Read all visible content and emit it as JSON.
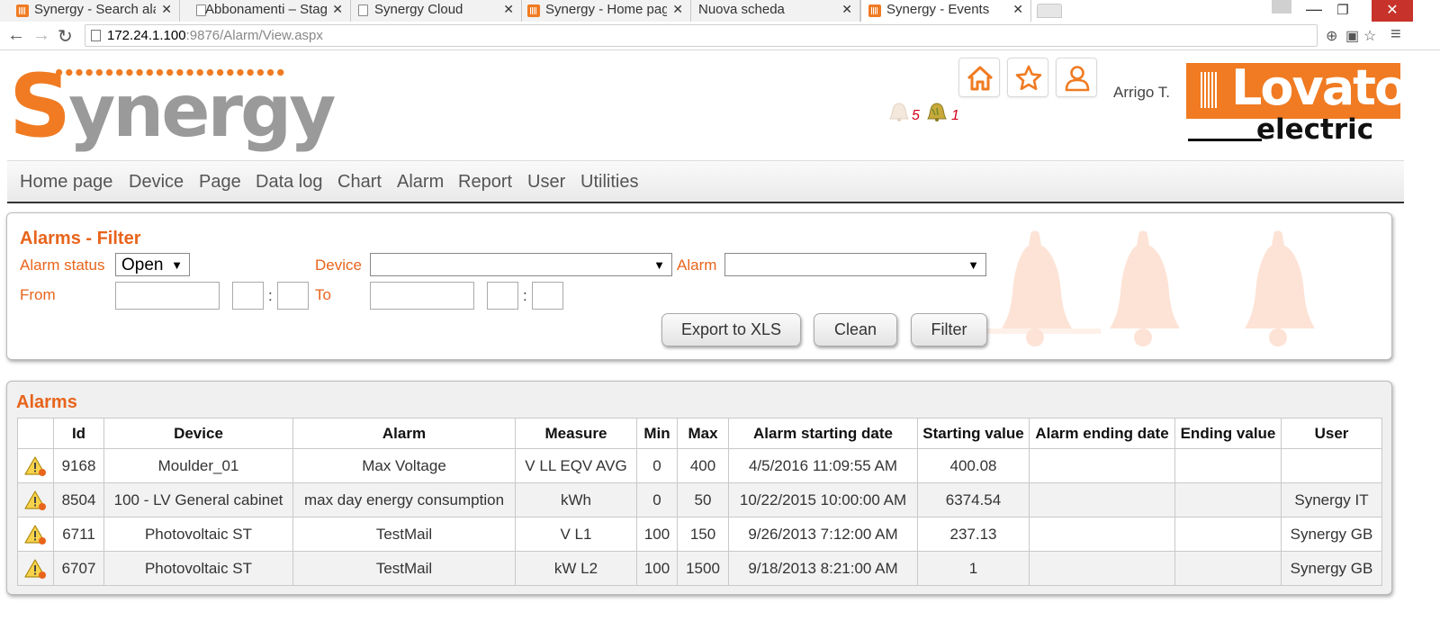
{
  "browser": {
    "tabs": [
      {
        "title": "Synergy - Search alarms",
        "active": false,
        "icon": "synergy-favicon"
      },
      {
        "title": "Abbonamenti – Stagione",
        "active": false,
        "icon": "page-icon"
      },
      {
        "title": "Synergy Cloud",
        "active": false,
        "icon": "page-icon"
      },
      {
        "title": "Synergy - Home page",
        "active": false,
        "icon": "synergy-favicon"
      },
      {
        "title": "Nuova scheda",
        "active": false,
        "icon": "none"
      },
      {
        "title": "Synergy - Events",
        "active": true,
        "icon": "synergy-favicon"
      }
    ],
    "url_host": "172.24.1.100",
    "url_rest": ":9876/Alarm/View.aspx"
  },
  "header": {
    "logo_text": "Synergy",
    "username": "Arrigo T.",
    "buttons": [
      {
        "name": "home",
        "icon": "home-icon"
      },
      {
        "name": "favorites",
        "icon": "star-icon"
      },
      {
        "name": "user",
        "icon": "user-icon"
      }
    ],
    "alarm_counters": [
      {
        "icon": "bell-inactive-icon",
        "count": "5"
      },
      {
        "icon": "bell-active-icon",
        "count": "1"
      }
    ],
    "brand": {
      "name": "Lovato",
      "sub": "electric"
    },
    "accent_color": "#f07b22"
  },
  "menu": {
    "items": [
      "Home page",
      "Device",
      "Page",
      "Data log",
      "Chart",
      "Alarm",
      "Report",
      "User",
      "Utilities"
    ]
  },
  "filter": {
    "title": "Alarms - Filter",
    "alarm_status_label": "Alarm status",
    "alarm_status_value": "Open",
    "device_label": "Device",
    "device_value": "",
    "alarm_label": "Alarm",
    "alarm_value": "",
    "from_label": "From",
    "to_label": "To",
    "buttons": {
      "export": "Export to XLS",
      "clean": "Clean",
      "filter": "Filter"
    }
  },
  "alarms": {
    "title": "Alarms",
    "columns": [
      "",
      "Id",
      "Device",
      "Alarm",
      "Measure",
      "Min",
      "Max",
      "Alarm starting date",
      "Starting value",
      "Alarm ending date",
      "Ending value",
      "User"
    ],
    "rows": [
      {
        "id": "9168",
        "device": "Moulder_01",
        "alarm": "Max Voltage",
        "measure": "V LL EQV AVG",
        "min": "0",
        "max": "400",
        "start": "4/5/2016 11:09:55 AM",
        "start_value": "400.08",
        "end": "",
        "end_value": "",
        "user": ""
      },
      {
        "id": "8504",
        "device": "100 - LV General cabinet",
        "alarm": "max day energy consumption",
        "measure": "kWh",
        "min": "0",
        "max": "50",
        "start": "10/22/2015 10:00:00 AM",
        "start_value": "6374.54",
        "end": "",
        "end_value": "",
        "user": "Synergy IT"
      },
      {
        "id": "6711",
        "device": "Photovoltaic ST",
        "alarm": "TestMail",
        "measure": "V L1",
        "min": "100",
        "max": "150",
        "start": "9/26/2013 7:12:00 AM",
        "start_value": "237.13",
        "end": "",
        "end_value": "",
        "user": "Synergy GB"
      },
      {
        "id": "6707",
        "device": "Photovoltaic ST",
        "alarm": "TestMail",
        "measure": "kW L2",
        "min": "100",
        "max": "1500",
        "start": "9/18/2013 8:21:00 AM",
        "start_value": "1",
        "end": "",
        "end_value": "",
        "user": "Synergy GB"
      }
    ]
  }
}
